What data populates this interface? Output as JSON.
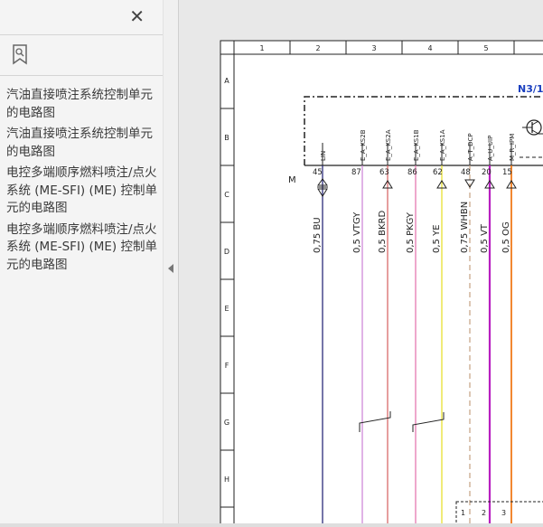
{
  "sidebar": {
    "close_label": "✕",
    "bookmarks": [
      "汽油直接喷注系统控制单元的电路图",
      "汽油直接喷注系统控制单元的电路图",
      "电控多端顺序燃料喷注/点火系统 (ME-SFI) (ME) 控制单元的电路图",
      "电控多端顺序燃料喷注/点火系统 (ME-SFI) (ME) 控制单元的电路图"
    ]
  },
  "diagram": {
    "columns": [
      "1",
      "2",
      "3",
      "4",
      "5"
    ],
    "rows": [
      "A",
      "B",
      "C",
      "D",
      "E",
      "F",
      "G",
      "H"
    ],
    "component": "N3/1",
    "ground_label": "M",
    "bottom_pins": [
      "1",
      "2",
      "3"
    ],
    "signals": [
      {
        "name": "LIN",
        "pin": "45",
        "wire": "0,75 BU",
        "color": "#2b2b7a"
      },
      {
        "name": "E_A_KS2B",
        "pin": "87",
        "wire": "0,5 VTGY",
        "color": "#d08ad8"
      },
      {
        "name": "E_A_KS2A",
        "pin": "63",
        "wire": "0,5 BKRD",
        "color": "#d96a6a"
      },
      {
        "name": "E_A_KS1B",
        "pin": "86",
        "wire": "0,5 PKGY",
        "color": "#e47ab0"
      },
      {
        "name": "E_A_KS1A",
        "pin": "62",
        "wire": "0,5 YE",
        "color": "#e8e030"
      },
      {
        "name": "A_T_DCP",
        "pin": "48",
        "wire": "0,75 WHBN",
        "color": "#caa88a"
      },
      {
        "name": "A_U_UIP",
        "pin": "20",
        "wire": "0,5 VT",
        "color": "#b81fc0"
      },
      {
        "name": "M_R_IPM",
        "pin": "15",
        "wire": "0,5 OG",
        "color": "#f07a1a"
      }
    ]
  }
}
